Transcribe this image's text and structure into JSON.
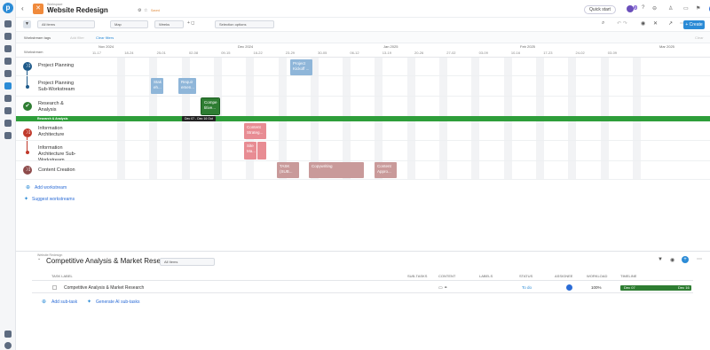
{
  "app": {
    "breadcrumb": "Workspace",
    "title": "Website Redesign",
    "saved": "Saved",
    "quick_start": "Quick start",
    "create": "+ Create",
    "user_initial": "S"
  },
  "toolbar": {
    "all_items": "All items",
    "view": "Map",
    "scale": "Weeks",
    "selection": "Selection options",
    "avatar_count": "2"
  },
  "filters": {
    "workstream_tags": "Workstream tags",
    "add_filter": "Add filter",
    "clear": "Clear filters",
    "right_clear": "Clear"
  },
  "timeline": {
    "col_label": "Workstream",
    "months": [
      "Nov 2024",
      "Dec 2024",
      "Jan 2025",
      "Feb 2025",
      "Mar 2025"
    ],
    "weeks": [
      "11-17",
      "18-24",
      "25-01",
      "02-08",
      "09-15",
      "16-22",
      "23-29",
      "30-05",
      "06-12",
      "13-19",
      "20-26",
      "27-02",
      "03-09",
      "10-16",
      "17-23",
      "24-02",
      "03-09"
    ]
  },
  "workstreams": [
    {
      "name": "Project Planning",
      "color": "#1e5a8a",
      "icon": "⤨"
    },
    {
      "name": "Project Planning Sub-Workstream",
      "color": "#1e5a8a"
    },
    {
      "name": "Research & Analysis",
      "color": "#2e7d32",
      "icon": "✔"
    },
    {
      "name": "Information Architecture",
      "color": "#c0392b",
      "icon": "⤨"
    },
    {
      "name": "Information Architecture Sub-Workstream",
      "color": "#c0392b"
    },
    {
      "name": "Content Creation",
      "color": "#8e4b4b",
      "icon": "⤨"
    }
  ],
  "tasks": {
    "kickoff": "Project Kickoff ...",
    "stakeholder": "Stak eh...",
    "requirements": "Requir emen...",
    "compe": "Compe titive...",
    "strategy": "Content Strateg...",
    "sitemap": "Site Ma...",
    "task": "TASK (SUB...",
    "copywriting": "Copywriting",
    "approval": "Content Appro..."
  },
  "active_bar": {
    "label": "Research & Analysis",
    "tooltip": "Dec 07 - Dec 16 Out"
  },
  "add_ws": "Add workstream",
  "suggest_ws": "Suggest workstreams",
  "detail": {
    "breadcrumb": "Website Redesign",
    "title": "Competitive Analysis & Market Research",
    "filter": "All Items",
    "headers": [
      "TASK LABEL",
      "SUB-TASKS",
      "CONTENT",
      "LABELS",
      "STATUS",
      "ASSIGNEE",
      "WORKLOAD",
      "TIMELINE"
    ],
    "row": {
      "label": "Competitive Analysis & Market Research",
      "status": "To do",
      "workload": "100%",
      "start": "Dec 07",
      "end": "Dec 16"
    },
    "add_sub": "Add sub-task",
    "gen_ai": "Generate AI sub-tasks"
  }
}
